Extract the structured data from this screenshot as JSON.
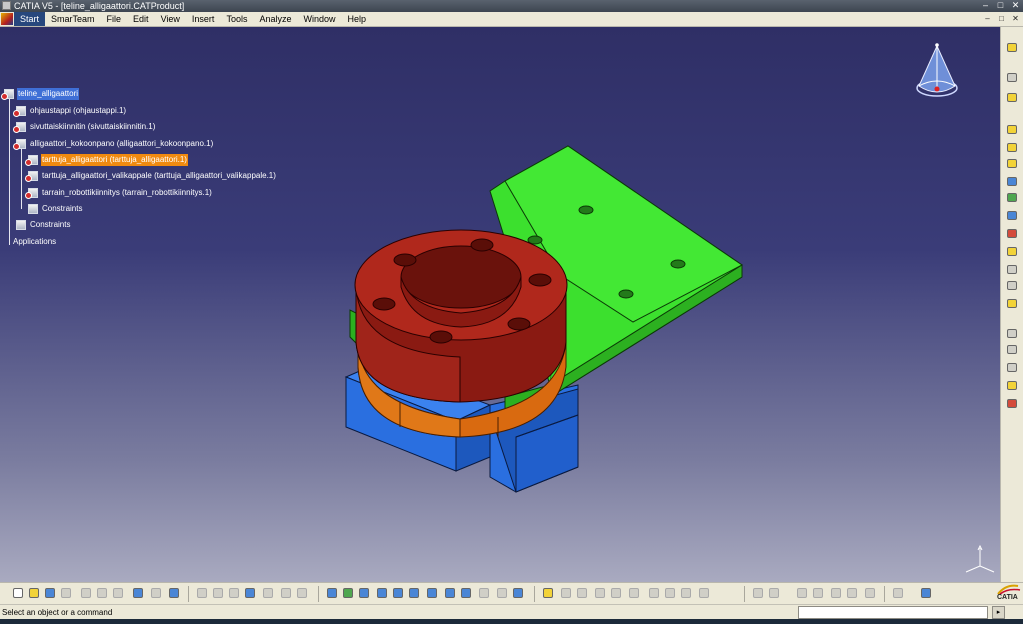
{
  "window": {
    "title": "CATIA V5 - [teline_alligaattori.CATProduct]",
    "min_glyph": "–",
    "max_glyph": "□",
    "close_glyph": "✕"
  },
  "menubar": {
    "items": [
      "Start",
      "SmarTeam",
      "File",
      "Edit",
      "View",
      "Insert",
      "Tools",
      "Analyze",
      "Window",
      "Help"
    ],
    "active": "Start",
    "doc_min_glyph": "–",
    "doc_max_glyph": "□",
    "doc_close_glyph": "✕"
  },
  "tree": {
    "root": "teline_alligaattori",
    "items": [
      "ohjaustappi (ohjaustappi.1)",
      "sivuttaiskiinnitin (sivuttaiskiinnitin.1)",
      "alligaattori_kokoonpano (alligaattori_kokoonpano.1)",
      "tarttuja_alligaattori (tarttuja_alligaattori.1)",
      "tarttuja_alligaattori_valikappale (tarttuja_alligaattori_valikappale.1)",
      "tarrain_robottikiinnitys (tarrain_robottikiinnitys.1)",
      "Constraints",
      "Constraints",
      "Applications"
    ]
  },
  "colors": {
    "background_top": "#2f2f66",
    "background_bottom": "#a9aac0",
    "part_plate": "#3ce02e",
    "part_ring": "#8a1a12",
    "part_spacer": "#d96a10",
    "part_base": "#2a6fe0",
    "selection_orange": "#f08a10",
    "selection_blue": "#3f6fd6"
  },
  "statusbar": {
    "message": "Select an object or a command",
    "cmd_button_glyph": "▸"
  },
  "brand": {
    "logo_text": "CATIA"
  }
}
